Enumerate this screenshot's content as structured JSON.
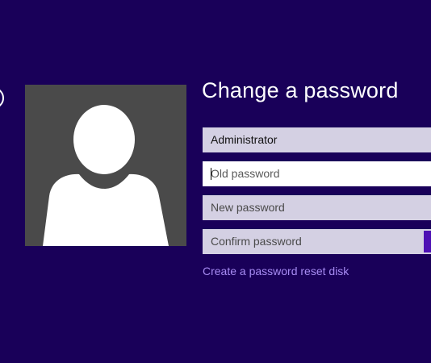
{
  "title": "Change a password",
  "form": {
    "username": "Administrator",
    "old_password_placeholder": "Old password",
    "new_password_placeholder": "New password",
    "confirm_password_placeholder": "Confirm password",
    "reset_link": "Create a password reset disk"
  },
  "colors": {
    "background": "#190059",
    "avatar_background": "#4a4a4a",
    "field_background": "#d4d0e3",
    "active_field_background": "#ffffff",
    "link": "#a78bf3",
    "submit_accent": "#4d10b4"
  },
  "icons": {
    "back": "back-arrow-icon",
    "avatar": "user-silhouette-icon",
    "submit": "submit-arrow-icon"
  }
}
